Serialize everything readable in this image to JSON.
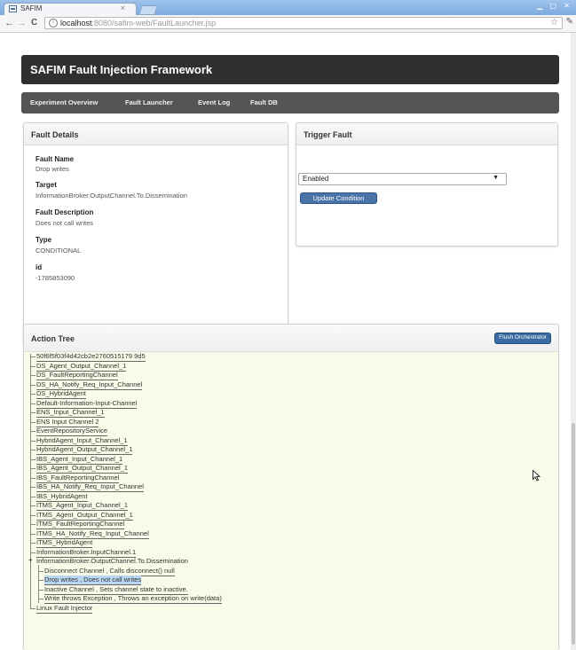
{
  "browser": {
    "tab_title": "SAFIM",
    "tab_close": "×",
    "back": "←",
    "forward": "→",
    "reload": "C",
    "url_host": "localhost",
    "url_path": ":8080/safim-web/FaultLauncher.jsp",
    "star": "☆",
    "menu": "🔧"
  },
  "app": {
    "title": "SAFIM Fault Injection Framework",
    "nav": [
      "Experiment Overview",
      "Fault Launcher",
      "Event Log",
      "Fault DB"
    ]
  },
  "fault_details": {
    "heading": "Fault Details",
    "fields": [
      {
        "label": "Fault Name",
        "value": "Drop writes"
      },
      {
        "label": "Target",
        "value": "InformationBroker.OutputChannel.To.Dissemination"
      },
      {
        "label": "Fault Description",
        "value": "Does not call writes"
      },
      {
        "label": "Type",
        "value": "CONDITIONAL"
      },
      {
        "label": "id",
        "value": "-1785853090"
      }
    ]
  },
  "trigger_fault": {
    "heading": "Trigger Fault",
    "condition_value": "Enabled",
    "button_label": "Update Condition"
  },
  "action_tree": {
    "heading": "Action Tree",
    "flush_label": "Flush Orchestrator",
    "items": [
      {
        "label": "50f6f5f03f4d42cb2e2760515179 9d5",
        "type": "node"
      },
      {
        "label": "DS_Agent_Output_Channel_1",
        "type": "node"
      },
      {
        "label": "DS_FaultReportingChannel",
        "type": "node"
      },
      {
        "label": "DS_HA_Notify_Req_Input_Channel",
        "type": "node"
      },
      {
        "label": "DS_HybridAgent",
        "type": "node"
      },
      {
        "label": "Default-Information-Input-Channel",
        "type": "node"
      },
      {
        "label": "ENS_Input_Channel_1",
        "type": "node"
      },
      {
        "label": "ENS Input Channel 2",
        "type": "node"
      },
      {
        "label": "EventRepositoryService",
        "type": "node"
      },
      {
        "label": "HybridAgent_Input_Channel_1",
        "type": "node"
      },
      {
        "label": "HybridAgent_Output_Channel_1",
        "type": "node"
      },
      {
        "label": "IBS_Agent_Input_Channel_1",
        "type": "node"
      },
      {
        "label": "IBS_Agent_Output_Channel_1",
        "type": "node"
      },
      {
        "label": "IBS_FaultReportingChannel",
        "type": "node"
      },
      {
        "label": "IBS_HA_Notify_Req_Input_Channel",
        "type": "node"
      },
      {
        "label": "IBS_HybridAgent",
        "type": "node"
      },
      {
        "label": "ITMS_Agent_Input_Channel_1",
        "type": "node"
      },
      {
        "label": "ITMS_Agent_Output_Channel_1",
        "type": "node"
      },
      {
        "label": "ITMS_FaultReportingChannel",
        "type": "node"
      },
      {
        "label": "ITMS_HA_Notify_Req_Input_Channel",
        "type": "node"
      },
      {
        "label": "ITMS_HybridAgent",
        "type": "node"
      },
      {
        "label": "InformationBroker.InputChannel.1",
        "type": "node"
      },
      {
        "label": "InformationBroker.OutputChannel.To.Dissemination",
        "type": "expanded",
        "expander": "+"
      },
      {
        "label": "Disconnect Channel , Calls disconnect() null",
        "type": "child"
      },
      {
        "label": "Drop writes , Does not call writes",
        "type": "child",
        "selected": true
      },
      {
        "label": "Inactive Channel , Sets channel state to inactive.",
        "type": "child"
      },
      {
        "label": "Write throws Exception , Throws an exception on write(data)",
        "type": "child"
      },
      {
        "label": "Linux Fault Injector",
        "type": "node"
      }
    ]
  },
  "colors": {
    "header_bg": "#2f2f2f",
    "nav_bg": "#555555",
    "button_blue": "#4a74a8",
    "tree_bg": "#fafae8",
    "selected_bg": "#b9d7f2"
  }
}
